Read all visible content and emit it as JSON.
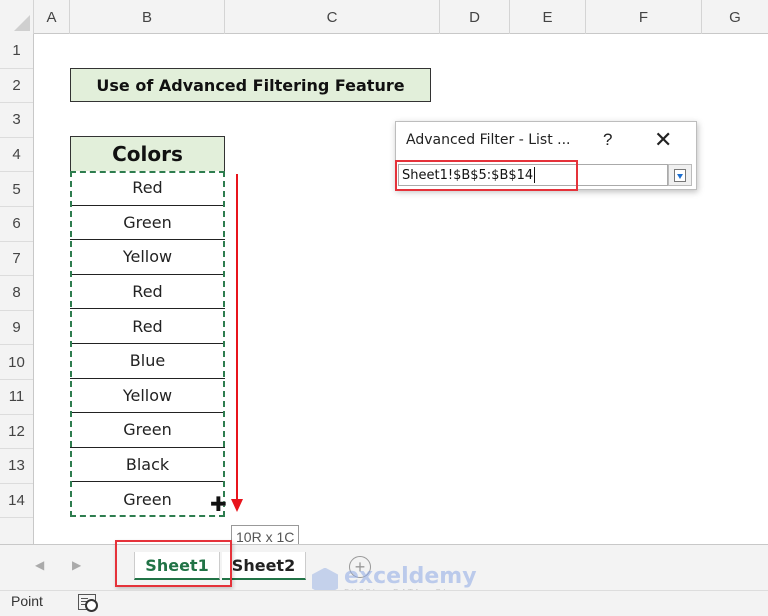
{
  "columns": [
    "A",
    "B",
    "C",
    "D",
    "E",
    "F",
    "G"
  ],
  "rows": [
    "1",
    "2",
    "3",
    "4",
    "5",
    "6",
    "7",
    "8",
    "9",
    "10",
    "11",
    "12",
    "13",
    "14"
  ],
  "sheet": {
    "title": "Use of Advanced Filtering Feature",
    "table_header": "Colors",
    "colors": [
      "Red",
      "Green",
      "Yellow",
      "Red",
      "Red",
      "Blue",
      "Yellow",
      "Green",
      "Black",
      "Green"
    ]
  },
  "selection_tooltip": "10R x 1C",
  "dialog": {
    "title": "Advanced Filter - List ...",
    "help": "?",
    "close": "✕",
    "range_value": "Sheet1!$B$5:$B$14",
    "collapse_icon": "collapse-dialog-icon"
  },
  "tabs": [
    {
      "label": "Sheet1",
      "active": true
    },
    {
      "label": "Sheet2",
      "active": false
    }
  ],
  "nav": {
    "prev": "◀",
    "next": "▶",
    "add": "+"
  },
  "watermark": {
    "main": "exceldemy",
    "sub": "EXCEL - DATA - BI"
  },
  "status": {
    "mode": "Point"
  },
  "colors_theme": {
    "accent": "#217346",
    "header_fill": "#e2efda",
    "highlight": "#e5323a"
  }
}
